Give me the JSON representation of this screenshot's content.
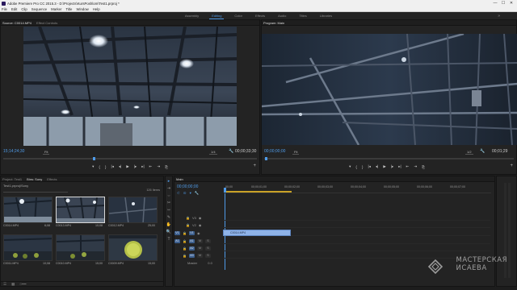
{
  "titlebar": {
    "title": "Adobe Premiere Pro CC 2015.3 - D:\\Projects\\KursPoshlom\\Test1.prproj *",
    "minimize": "—",
    "maximize": "☐",
    "close": "✕"
  },
  "menu": [
    "File",
    "Edit",
    "Clip",
    "Sequence",
    "Marker",
    "Title",
    "Window",
    "Help"
  ],
  "workspaces": {
    "items": [
      "Assembly",
      "Editing",
      "Color",
      "Effects",
      "Audio",
      "Titles",
      "Libraries"
    ],
    "active_index": 1,
    "more": "»"
  },
  "source": {
    "tabs": [
      "Source: C0014.MP4",
      "Effect Controls"
    ],
    "timecode_left": "15;14;24;30",
    "timecode_right": "00;00;33;30",
    "fit": "Fit",
    "resolution": "1/4"
  },
  "program": {
    "tabs": [
      "Program: Main"
    ],
    "timecode_left": "00;00;00;00",
    "timecode_right": "00;01;29",
    "fit": "Fit",
    "resolution": "1/2"
  },
  "transport_icons": [
    "▾",
    "{",
    "}",
    "|◂",
    "◂|",
    "▶",
    "|▸",
    "▸|",
    "⇤",
    "⇥",
    "⎘",
    "+"
  ],
  "project": {
    "tabs": [
      "Project: Test1",
      "Bins: Sony",
      "Effects"
    ],
    "project_name": "Test1.prproj\\Sony",
    "items_count": "126 Items",
    "search_placeholder": "",
    "clips": [
      {
        "name": "C0014.MP4",
        "duration": "6;08"
      },
      {
        "name": "C0013.MP4",
        "duration": "10;08"
      },
      {
        "name": "C0012.MP4",
        "duration": "25;00"
      },
      {
        "name": "C0011.MP4",
        "duration": "10;08"
      },
      {
        "name": "C0010.MP4",
        "duration": "15;00"
      },
      {
        "name": "C0009.MP4",
        "duration": "15;00"
      }
    ]
  },
  "tools": [
    "▸",
    "⇥",
    "⇔",
    "✂",
    "⇿",
    "✎",
    "✋",
    "🔍",
    "T"
  ],
  "timeline": {
    "tabs": [
      "Main"
    ],
    "timecode": "00;00;00;00",
    "ruler_labels": [
      "00;00",
      "00;00;01;00",
      "00;00;02;00",
      "00;00;03;00",
      "00;00;04;00",
      "00;00;05;00",
      "00;00;06;00",
      "00;00;07;00"
    ],
    "video_tracks": [
      "V3",
      "V2",
      "V1"
    ],
    "audio_tracks": [
      "A1",
      "A2",
      "A3"
    ],
    "master_label": "Master",
    "master_value": "0.0",
    "source_patch_video": "V1",
    "source_patch_audio": "A1",
    "clip_name": "C0014.MP4",
    "toggles": {
      "M": "M",
      "S": "S"
    }
  },
  "watermark": {
    "line1": "МАСТЕРСКАЯ",
    "line2": "ИСАЕВА"
  }
}
